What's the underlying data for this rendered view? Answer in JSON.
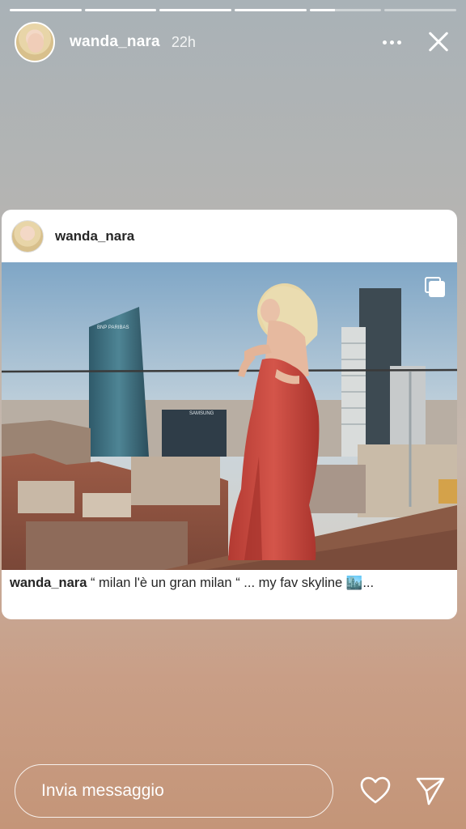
{
  "story": {
    "progress_segments": [
      1,
      1,
      1,
      1,
      0.35,
      0
    ],
    "username": "wanda_nara",
    "timestamp": "22h"
  },
  "post": {
    "username": "wanda_nara",
    "caption_user": "wanda_nara",
    "caption_text": "“ milan l'è un gran milan “ ... my fav skyline 🏙️..."
  },
  "footer": {
    "message_placeholder": "Invia messaggio"
  },
  "icons": {
    "more": "more-horizontal-icon",
    "close": "close-icon",
    "multi": "multiple-images-icon",
    "heart": "heart-icon",
    "send": "send-icon"
  },
  "colors": {
    "accent_dress": "#c9473b",
    "text_dark": "#262626"
  }
}
